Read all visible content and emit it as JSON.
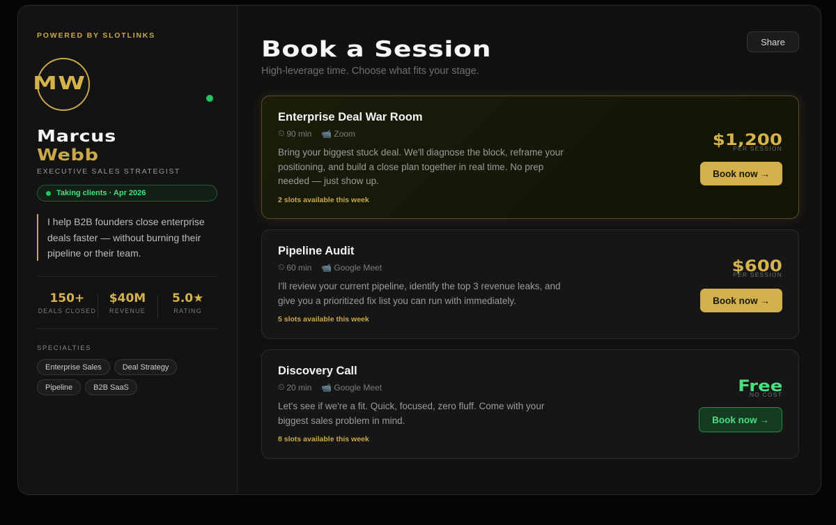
{
  "sidebar": {
    "powered_by": "POWERED BY SLOTLINKS",
    "avatar_initials": "MW",
    "name_first": "Marcus",
    "name_last": "Webb",
    "role": "EXECUTIVE SALES STRATEGIST",
    "status": "Taking clients · Apr 2026",
    "bio": "I help B2B founders close enterprise deals faster — without burning their pipeline or their team.",
    "stats": [
      {
        "value": "150+",
        "label": "DEALS CLOSED"
      },
      {
        "value": "$40M",
        "label": "REVENUE"
      },
      {
        "value": "5.0★",
        "label": "RATING"
      }
    ],
    "specialties_title": "SPECIALTIES",
    "specialties": [
      "Enterprise Sales",
      "Deal Strategy",
      "Pipeline",
      "B2B SaaS"
    ]
  },
  "main": {
    "title": "Book a Session",
    "subtitle": "High-leverage time. Choose what fits your stage.",
    "share_label": "Share",
    "sessions": [
      {
        "title": "Enterprise Deal War Room",
        "duration": "90 min",
        "platform": "Zoom",
        "description": "Bring your biggest stuck deal. We'll diagnose the block, reframe your positioning, and build a close plan together in real time. No prep needed — just show up.",
        "slots": "2 slots available this week",
        "price": "$1,200",
        "price_note": "PER SESSION",
        "cta": "Book now →"
      },
      {
        "title": "Pipeline Audit",
        "duration": "60 min",
        "platform": "Google Meet",
        "description": "I'll review your current pipeline, identify the top 3 revenue leaks, and give you a prioritized fix list you can run with immediately.",
        "slots": "5 slots available this week",
        "price": "$600",
        "price_note": "PER SESSION",
        "cta": "Book now →"
      },
      {
        "title": "Discovery Call",
        "duration": "20 min",
        "platform": "Google Meet",
        "description": "Let's see if we're a fit. Quick, focused, zero fluff. Come with your biggest sales problem in mind.",
        "slots": "8 slots available this week",
        "price": "Free",
        "price_note": "NO COST",
        "cta": "Book now →"
      }
    ]
  },
  "icons": {
    "clock": "clock-icon",
    "video": "video-camera-icon"
  },
  "colors": {
    "accent_gold": "#c9a94a",
    "success_green": "#22c55e",
    "background": "#111111"
  }
}
